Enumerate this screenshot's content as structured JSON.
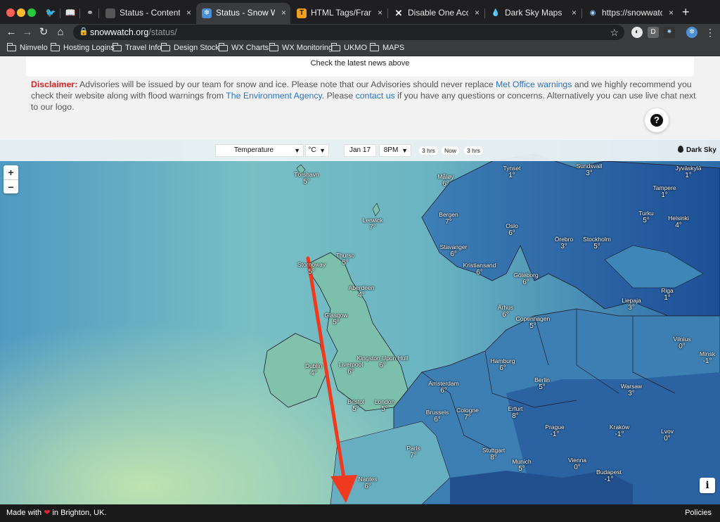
{
  "tabs": {
    "pinned": [
      "🐦",
      "📖",
      "⚭"
    ],
    "items": [
      {
        "label": "Status - Content - Pro",
        "icon": "page-icon",
        "active": false
      },
      {
        "label": "Status - Snow Watch U",
        "icon": "snowflake-icon",
        "active": true
      },
      {
        "label": "HTML Tags/Frame Tag",
        "icon": "t-icon",
        "active": false
      },
      {
        "label": "Disable One Accordion",
        "icon": "x-icon",
        "active": false
      },
      {
        "label": "Dark Sky Maps",
        "icon": "darksky-icon",
        "active": false
      },
      {
        "label": "https://snowwatch.org",
        "icon": "globe-icon",
        "active": false
      }
    ],
    "close_glyph": "×",
    "new_tab_glyph": "+"
  },
  "toolbar": {
    "back": "←",
    "forward": "→",
    "reload": "↻",
    "home": "⌂",
    "url_host": "snowwatch.org",
    "url_path": "/status/",
    "star": "☆",
    "ext_d": "D"
  },
  "bookmarks": [
    "Nimvelo",
    "Hosting Logins",
    "Travel Info",
    "Design Stock",
    "WX Charts",
    "WX Monitoring",
    "UKMO",
    "MAPS"
  ],
  "page": {
    "news": "Check the latest news above",
    "disclaimer": {
      "label": "Disclaimer:",
      "t1": " Advisories will be issued by our team for snow and ice. Please note that our Advisories should never replace ",
      "link1": "Met Office warnings",
      "t2": " and we highly recommend you check their website along with flood warnings from ",
      "link2": "The Environment Agency",
      "t3": ". Please ",
      "link3": "contact us",
      "t4": " if you have any questions or concerns. Alternatively you can use live chat next to our logo."
    },
    "help_glyph": "?"
  },
  "map": {
    "layer": "Temperature",
    "unit": "°C",
    "date": "Jan 17",
    "time": "8PM",
    "back_step": "3 hrs",
    "now": "Now",
    "fwd_step": "3 hrs",
    "brand": "Dark Sky",
    "zoom_in": "+",
    "zoom_out": "−",
    "info": "i",
    "cities": [
      {
        "name": "Tórshavn",
        "temp": "5°"
      },
      {
        "name": "Lerwick",
        "temp": "7°"
      },
      {
        "name": "Thurso",
        "temp": "5°"
      },
      {
        "name": "Stornoway",
        "temp": "5°"
      },
      {
        "name": "Aberdeen",
        "temp": "4°"
      },
      {
        "name": "Glasgow",
        "temp": "5°"
      },
      {
        "name": "Dublin",
        "temp": "4°"
      },
      {
        "name": "Liverpool",
        "temp": "6°"
      },
      {
        "name": "Kingston Upon Hull",
        "temp": "6°"
      },
      {
        "name": "Bristol",
        "temp": "5°"
      },
      {
        "name": "London",
        "temp": "5°"
      },
      {
        "name": "Paris",
        "temp": "7°"
      },
      {
        "name": "Nantes",
        "temp": "6°"
      },
      {
        "name": "Amsterdam",
        "temp": "6°"
      },
      {
        "name": "Brussels",
        "temp": "6°"
      },
      {
        "name": "Cologne",
        "temp": "7°"
      },
      {
        "name": "Hamburg",
        "temp": "6°"
      },
      {
        "name": "Erfurt",
        "temp": "8°"
      },
      {
        "name": "Stuttgart",
        "temp": "8°"
      },
      {
        "name": "Munich",
        "temp": "5°"
      },
      {
        "name": "Berlin",
        "temp": "5°"
      },
      {
        "name": "Prague",
        "temp": "-1°"
      },
      {
        "name": "Vienna",
        "temp": "0°"
      },
      {
        "name": "Budapest",
        "temp": "-1°"
      },
      {
        "name": "Kraków",
        "temp": "-1°"
      },
      {
        "name": "Warsaw",
        "temp": "3°"
      },
      {
        "name": "Lvov",
        "temp": "0°"
      },
      {
        "name": "Minsk",
        "temp": "-1°"
      },
      {
        "name": "Vilnius",
        "temp": "0°"
      },
      {
        "name": "Riga",
        "temp": "1°"
      },
      {
        "name": "Liepaja",
        "temp": "3°"
      },
      {
        "name": "Copenhagen",
        "temp": "5°"
      },
      {
        "name": "Århus",
        "temp": "6°"
      },
      {
        "name": "Göteborg",
        "temp": "6°"
      },
      {
        "name": "Kristiansand",
        "temp": "6°"
      },
      {
        "name": "Stavanger",
        "temp": "6°"
      },
      {
        "name": "Bergen",
        "temp": "7°"
      },
      {
        "name": "Oslo",
        "temp": "6°"
      },
      {
        "name": "Örebro",
        "temp": "3°"
      },
      {
        "name": "Stockholm",
        "temp": "5°"
      },
      {
        "name": "Turku",
        "temp": "5°"
      },
      {
        "name": "Helsinki",
        "temp": "4°"
      },
      {
        "name": "Tampere",
        "temp": "1°"
      },
      {
        "name": "Jyväskylä",
        "temp": "1°"
      },
      {
        "name": "Sundsvall",
        "temp": "3°"
      },
      {
        "name": "Tynset",
        "temp": "1°"
      },
      {
        "name": "Måløy",
        "temp": "6°"
      },
      {
        "name": "Östersund",
        "temp": "4°"
      }
    ]
  },
  "footer": {
    "made_pre": "Made with",
    "heart": "❤",
    "made_post": "in Brighton, UK.",
    "policies": "Policies"
  },
  "colors": {
    "arrow": "#f03a20",
    "link": "#2a73c9",
    "disclaimer_label": "#e02020"
  }
}
